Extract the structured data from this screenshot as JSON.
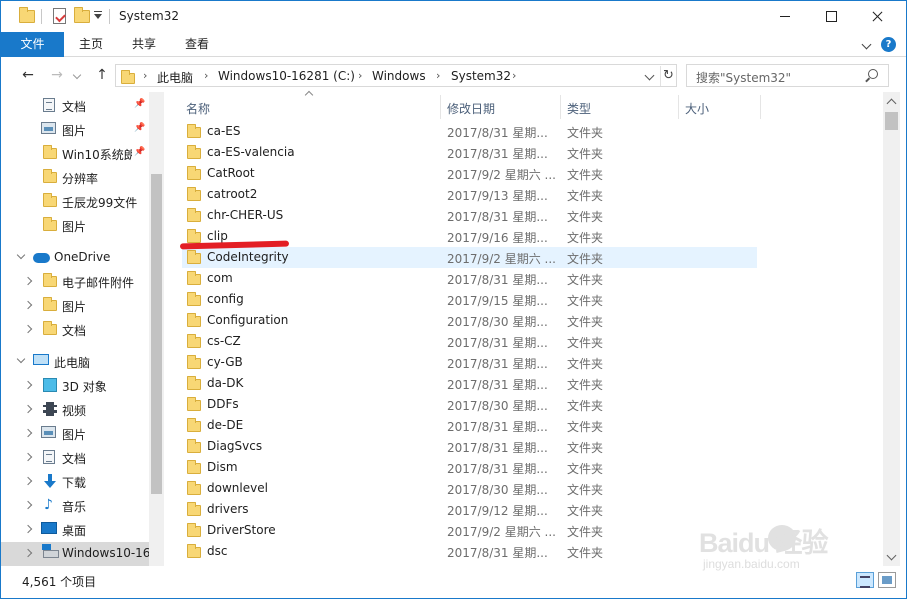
{
  "window": {
    "title": "System32"
  },
  "ribbon": {
    "tabs": [
      "文件",
      "主页",
      "共享",
      "查看"
    ]
  },
  "address": {
    "crumbs": [
      "此电脑",
      "Windows10-16281 (C:)",
      "Windows",
      "System32"
    ]
  },
  "search": {
    "placeholder": "搜索\"System32\""
  },
  "navpane": {
    "items": [
      {
        "label": "文档",
        "icon": "document-icon",
        "pinned": true
      },
      {
        "label": "图片",
        "icon": "picture-icon",
        "pinned": true
      },
      {
        "label": "Win10系统朗",
        "icon": "folder-icon",
        "pinned": true
      },
      {
        "label": "分辨率",
        "icon": "folder-icon",
        "pinned": false
      },
      {
        "label": "壬辰龙99文件",
        "icon": "folder-icon",
        "pinned": false
      },
      {
        "label": "图片",
        "icon": "folder-icon",
        "pinned": false
      },
      {
        "label": "OneDrive",
        "icon": "onedrive-cloud-icon",
        "pinned": false
      },
      {
        "label": "电子邮件附件",
        "icon": "folder-icon",
        "pinned": false
      },
      {
        "label": "图片",
        "icon": "folder-icon",
        "pinned": false
      },
      {
        "label": "文档",
        "icon": "folder-icon",
        "pinned": false
      },
      {
        "label": "此电脑",
        "icon": "this-pc-icon",
        "pinned": false
      },
      {
        "label": "3D 对象",
        "icon": "3d-objects-icon",
        "pinned": false
      },
      {
        "label": "视频",
        "icon": "video-icon",
        "pinned": false
      },
      {
        "label": "图片",
        "icon": "picture-icon",
        "pinned": false
      },
      {
        "label": "文档",
        "icon": "document-icon",
        "pinned": false
      },
      {
        "label": "下载",
        "icon": "download-icon",
        "pinned": false
      },
      {
        "label": "音乐",
        "icon": "music-icon",
        "pinned": false
      },
      {
        "label": "桌面",
        "icon": "desktop-icon",
        "pinned": false
      },
      {
        "label": "Windows10-16",
        "icon": "drive-icon",
        "pinned": false
      }
    ]
  },
  "columns": [
    "名称",
    "修改日期",
    "类型",
    "大小"
  ],
  "files": [
    {
      "name": "ca-ES",
      "date": "2017/8/31 星期...",
      "type": "文件夹"
    },
    {
      "name": "ca-ES-valencia",
      "date": "2017/8/31 星期...",
      "type": "文件夹"
    },
    {
      "name": "CatRoot",
      "date": "2017/9/2 星期六 ...",
      "type": "文件夹"
    },
    {
      "name": "catroot2",
      "date": "2017/9/13 星期...",
      "type": "文件夹"
    },
    {
      "name": "chr-CHER-US",
      "date": "2017/8/31 星期...",
      "type": "文件夹"
    },
    {
      "name": "clip",
      "date": "2017/9/16 星期...",
      "type": "文件夹"
    },
    {
      "name": "CodeIntegrity",
      "date": "2017/9/2 星期六 ...",
      "type": "文件夹"
    },
    {
      "name": "com",
      "date": "2017/8/31 星期...",
      "type": "文件夹"
    },
    {
      "name": "config",
      "date": "2017/9/15 星期...",
      "type": "文件夹"
    },
    {
      "name": "Configuration",
      "date": "2017/8/30 星期...",
      "type": "文件夹"
    },
    {
      "name": "cs-CZ",
      "date": "2017/8/31 星期...",
      "type": "文件夹"
    },
    {
      "name": "cy-GB",
      "date": "2017/8/31 星期...",
      "type": "文件夹"
    },
    {
      "name": "da-DK",
      "date": "2017/8/31 星期...",
      "type": "文件夹"
    },
    {
      "name": "DDFs",
      "date": "2017/8/30 星期...",
      "type": "文件夹"
    },
    {
      "name": "de-DE",
      "date": "2017/8/31 星期...",
      "type": "文件夹"
    },
    {
      "name": "DiagSvcs",
      "date": "2017/8/31 星期...",
      "type": "文件夹"
    },
    {
      "name": "Dism",
      "date": "2017/8/31 星期...",
      "type": "文件夹"
    },
    {
      "name": "downlevel",
      "date": "2017/8/30 星期...",
      "type": "文件夹"
    },
    {
      "name": "drivers",
      "date": "2017/9/12 星期...",
      "type": "文件夹"
    },
    {
      "name": "DriverStore",
      "date": "2017/9/2 星期六 ...",
      "type": "文件夹"
    },
    {
      "name": "dsc",
      "date": "2017/8/31 星期...",
      "type": "文件夹"
    }
  ],
  "status": {
    "item_count": "4,561 个项目"
  },
  "watermark": {
    "main": "Baidu 经验",
    "sub": "jingyan.baidu.com"
  },
  "colors": {
    "accent": "#1979ca",
    "folder": "#f8d775",
    "hover_row": "#e5f3ff",
    "annotation_red": "#e31e24"
  }
}
